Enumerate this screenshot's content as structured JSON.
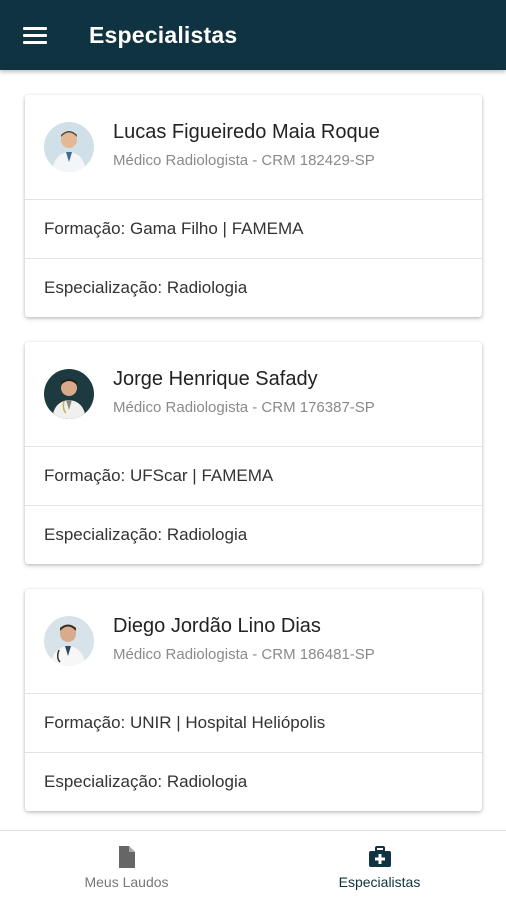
{
  "appbar": {
    "title": "Especialistas",
    "menu_icon": "hamburger-menu-icon",
    "background": "#0f3340"
  },
  "specialists": [
    {
      "name": "Lucas Figueiredo Maia Roque",
      "role": "Médico Radiologista - CRM 182429-SP",
      "formacao": "Formação: Gama Filho | FAMEMA",
      "especializacao": "Especialização: Radiologia",
      "avatar": "doctor-photo-avatar"
    },
    {
      "name": "Jorge Henrique Safady",
      "role": "Médico Radiologista - CRM 176387-SP",
      "formacao": "Formação: UFScar | FAMEMA",
      "especializacao": "Especialização: Radiologia",
      "avatar": "doctor-photo-avatar"
    },
    {
      "name": "Diego Jordão Lino Dias",
      "role": "Médico Radiologista - CRM 186481-SP",
      "formacao": "Formação: UNIR | Hospital Heliópolis",
      "especializacao": "Especialização: Radiologia",
      "avatar": "doctor-photo-avatar"
    }
  ],
  "bottom_nav": {
    "items": [
      {
        "label": "Meus Laudos",
        "icon": "document-icon",
        "active": false
      },
      {
        "label": "Especialistas",
        "icon": "medical-kit-icon",
        "active": true
      }
    ],
    "active_color": "#0f3340",
    "inactive_color": "#777777"
  }
}
